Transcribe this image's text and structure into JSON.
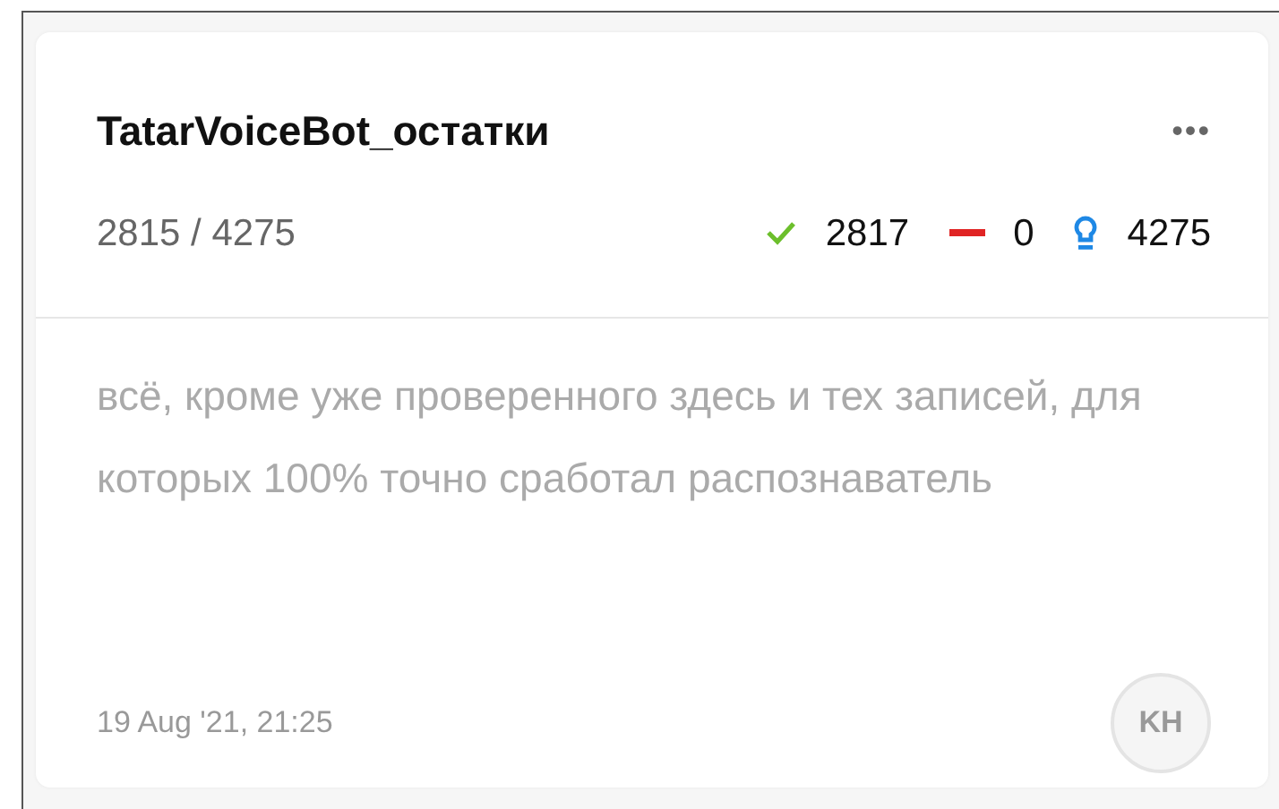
{
  "card": {
    "title": "TatarVoiceBot_остатки",
    "menu": "•••",
    "progress": "2815 / 4275",
    "stats": [
      {
        "kind": "accepted",
        "value": "2817"
      },
      {
        "kind": "rejected",
        "value": "0"
      },
      {
        "kind": "hint",
        "value": "4275"
      }
    ],
    "description": "всё, кроме уже проверенного здесь и тех записей, для которых 100% точно сработал распознаватель",
    "date": "19 Aug '21, 21:25",
    "avatar": "KH"
  }
}
